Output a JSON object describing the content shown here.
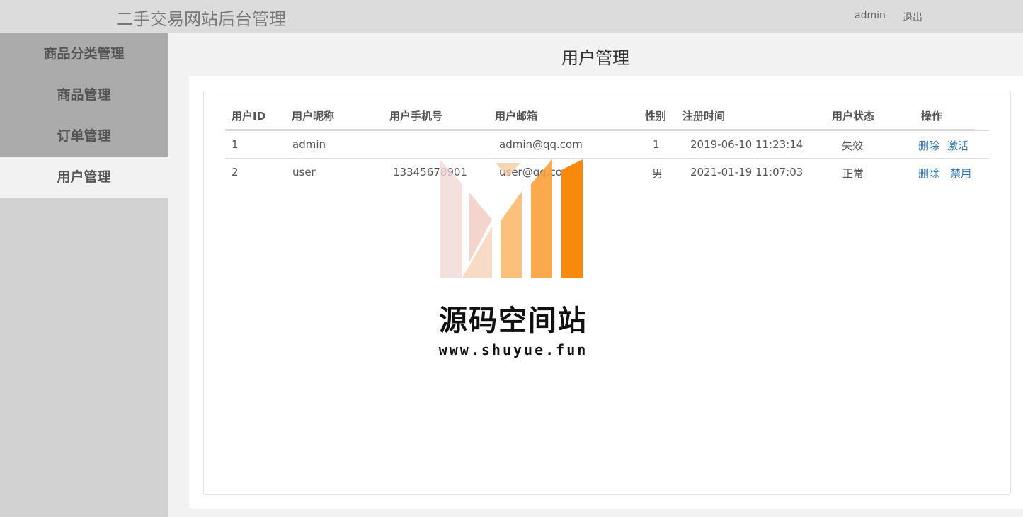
{
  "header": {
    "title": "二手交易网站后台管理",
    "user": "admin",
    "logout": "退出"
  },
  "sidebar": {
    "items": [
      {
        "label": "商品分类管理"
      },
      {
        "label": "商品管理"
      },
      {
        "label": "订单管理"
      },
      {
        "label": "用户管理",
        "active": true
      }
    ]
  },
  "main": {
    "title": "用户管理",
    "table": {
      "columns": [
        "用户ID",
        "用户昵称",
        "用户手机号",
        "用户邮箱",
        "性别",
        "注册时间",
        "用户状态",
        "操作"
      ],
      "rows": [
        {
          "id": "1",
          "nickname": "admin",
          "phone": "",
          "email": "admin@qq.com",
          "gender": "1",
          "registered": "2019-06-10 11:23:14",
          "status": "失效",
          "actions": [
            "删除",
            "激活"
          ]
        },
        {
          "id": "2",
          "nickname": "user",
          "phone": "13345678901",
          "email": "user@qq.com",
          "gender": "男",
          "registered": "2021-01-19 11:07:03",
          "status": "正常",
          "actions": [
            "删除",
            "禁用"
          ]
        }
      ]
    }
  },
  "watermark": {
    "name": "源码空间站",
    "url": "www.shuyue.fun"
  },
  "colors": {
    "topbar": "#dcdcdc",
    "sidebar": "#ababab",
    "link": "#337ab7",
    "watermark_orange": "#f78a0c"
  }
}
